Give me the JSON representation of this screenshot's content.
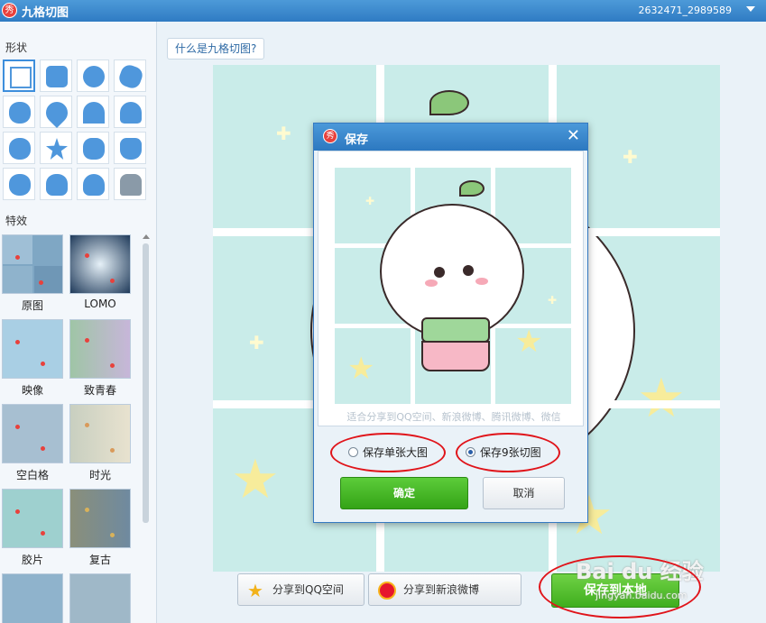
{
  "app": {
    "title": "九格切图",
    "logo_char": "秀",
    "account_id": "2632471_2989589"
  },
  "left_panel": {
    "shapes_label": "形状",
    "effects_label": "特效",
    "shapes": [
      "square",
      "rounded-square",
      "circle",
      "burst",
      "flower",
      "heart",
      "arch",
      "cloud",
      "apple",
      "star",
      "bear",
      "cat",
      "mouse",
      "duck",
      "penguin",
      "android"
    ],
    "effects": [
      {
        "label": "原图"
      },
      {
        "label": "LOMO"
      },
      {
        "label": "映像"
      },
      {
        "label": "致青春"
      },
      {
        "label": "空白格"
      },
      {
        "label": "时光"
      },
      {
        "label": "胶片"
      },
      {
        "label": "复古"
      }
    ]
  },
  "main": {
    "help_link": "什么是九格切图?",
    "share_qzone": "分享到QQ空间",
    "share_weibo": "分享到新浪微博",
    "save_local": "保存到本地"
  },
  "dialog": {
    "title": "保存",
    "share_hint": "适合分享到QQ空间、新浪微博、腾讯微博、微信",
    "option_single": "保存单张大图",
    "option_nine": "保存9张切图",
    "selected_option": "option_nine",
    "ok_label": "确定",
    "cancel_label": "取消"
  },
  "watermark": {
    "text": "Bai du 经验",
    "url": "jingyan.baidu.com"
  },
  "colors": {
    "accent_blue": "#2f7bc3",
    "ok_green": "#34a316",
    "canvas_bg": "#c9ece9",
    "annotation_red": "#e0141a"
  }
}
